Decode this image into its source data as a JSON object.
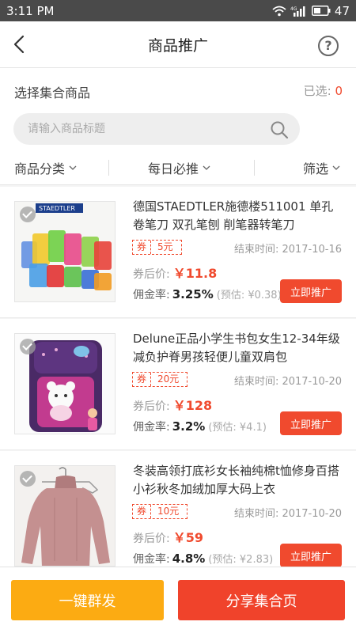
{
  "status": {
    "time": "3:11 PM",
    "battery": "47",
    "network": "4G"
  },
  "nav": {
    "title": "商品推广",
    "help_label": "?",
    "back_icon": "chevron-left-icon"
  },
  "select": {
    "label": "选择集合商品",
    "count_label": "已选:",
    "count": "0"
  },
  "search": {
    "placeholder": "请输入商品标题",
    "value": ""
  },
  "filters": [
    {
      "label": "商品分类"
    },
    {
      "label": "每日必推"
    },
    {
      "label": "筛选"
    }
  ],
  "items": [
    {
      "title": "德国STAEDTLER施德楼511001 单孔卷笔刀 双孔笔刨 削笔器转笔刀",
      "coupon_tag": "券",
      "coupon_amount": "5元",
      "end_time": "结束时间: 2017-10-16",
      "price_label": "券后价:",
      "price": "￥11.8",
      "commission_label": "佣金率:",
      "commission_rate": "3.25%",
      "estimate": "(预估: ¥0.38)",
      "button": "立即推广"
    },
    {
      "title": "Delune正品小学生书包女生12-34年级减负护脊男孩轻便儿童双肩包",
      "coupon_tag": "券",
      "coupon_amount": "20元",
      "end_time": "结束时间: 2017-10-20",
      "price_label": "券后价:",
      "price": "￥128",
      "commission_label": "佣金率:",
      "commission_rate": "3.2%",
      "estimate": "(预估: ¥4.1)",
      "button": "立即推广"
    },
    {
      "title": "冬装高领打底衫女长袖纯棉t恤修身百搭小衫秋冬加绒加厚大码上衣",
      "coupon_tag": "券",
      "coupon_amount": "10元",
      "end_time": "结束时间: 2017-10-20",
      "price_label": "券后价:",
      "price": "￥59",
      "commission_label": "佣金率:",
      "commission_rate": "4.8%",
      "estimate": "(预估: ¥2.83)",
      "button": "立即推广"
    }
  ],
  "thumb_text": {
    "brand": "STAEDTLER"
  },
  "bottom": {
    "bulk_label": "一键群发",
    "share_label": "分享集合页"
  },
  "colors": {
    "accent": "#f04a2e",
    "orange": "#fcab12",
    "status_bar": "#4a4a4a"
  }
}
